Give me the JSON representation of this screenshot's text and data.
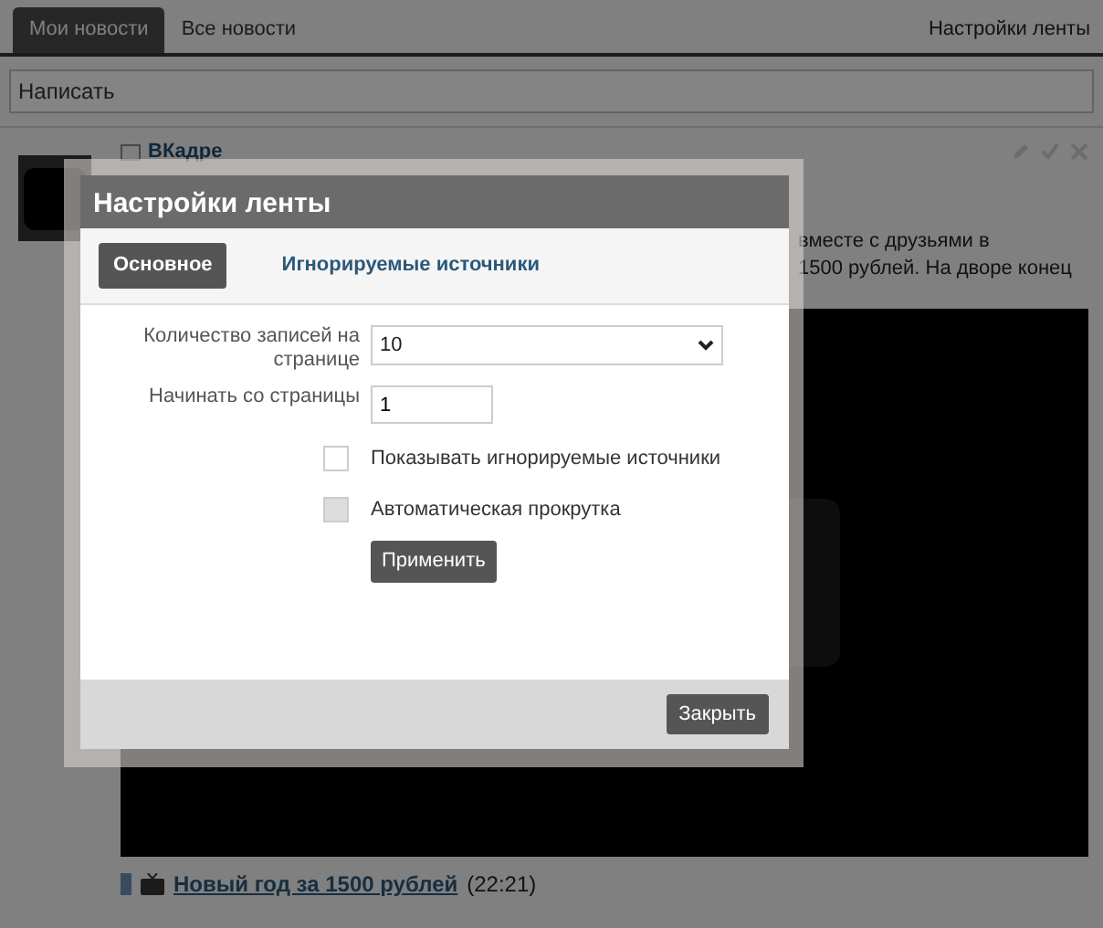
{
  "feed_tabs": [
    {
      "label": "Мои новости",
      "selected": true
    },
    {
      "label": "Все новости",
      "selected": false
    }
  ],
  "feed_settings_link": "Настройки ленты",
  "compose": {
    "placeholder": "Написать"
  },
  "post": {
    "author": "ВКадре",
    "text_lines": [
      "вместе с друзьями в",
      "1500 рублей. На дворе конец"
    ],
    "caption": "Новый год за 1500 рублей",
    "time": "(22:21)"
  },
  "modal": {
    "title": "Настройки ленты",
    "tabs": [
      {
        "label": "Основное",
        "selected": true
      },
      {
        "label": "Игнорируемые источники",
        "selected": false
      }
    ],
    "fields": [
      {
        "kind": "select",
        "label": "Количество записей на странице",
        "value": "10"
      },
      {
        "kind": "text",
        "label": "Начинать со страницы",
        "value": "1"
      }
    ],
    "checkboxes": [
      {
        "label": "Показывать игнорируемые источники",
        "checked": false,
        "disabled": false
      },
      {
        "label": "Автоматическая прокрутка",
        "checked": false,
        "disabled": true
      }
    ],
    "apply_button": "Применить",
    "close_button": "Закрыть"
  }
}
